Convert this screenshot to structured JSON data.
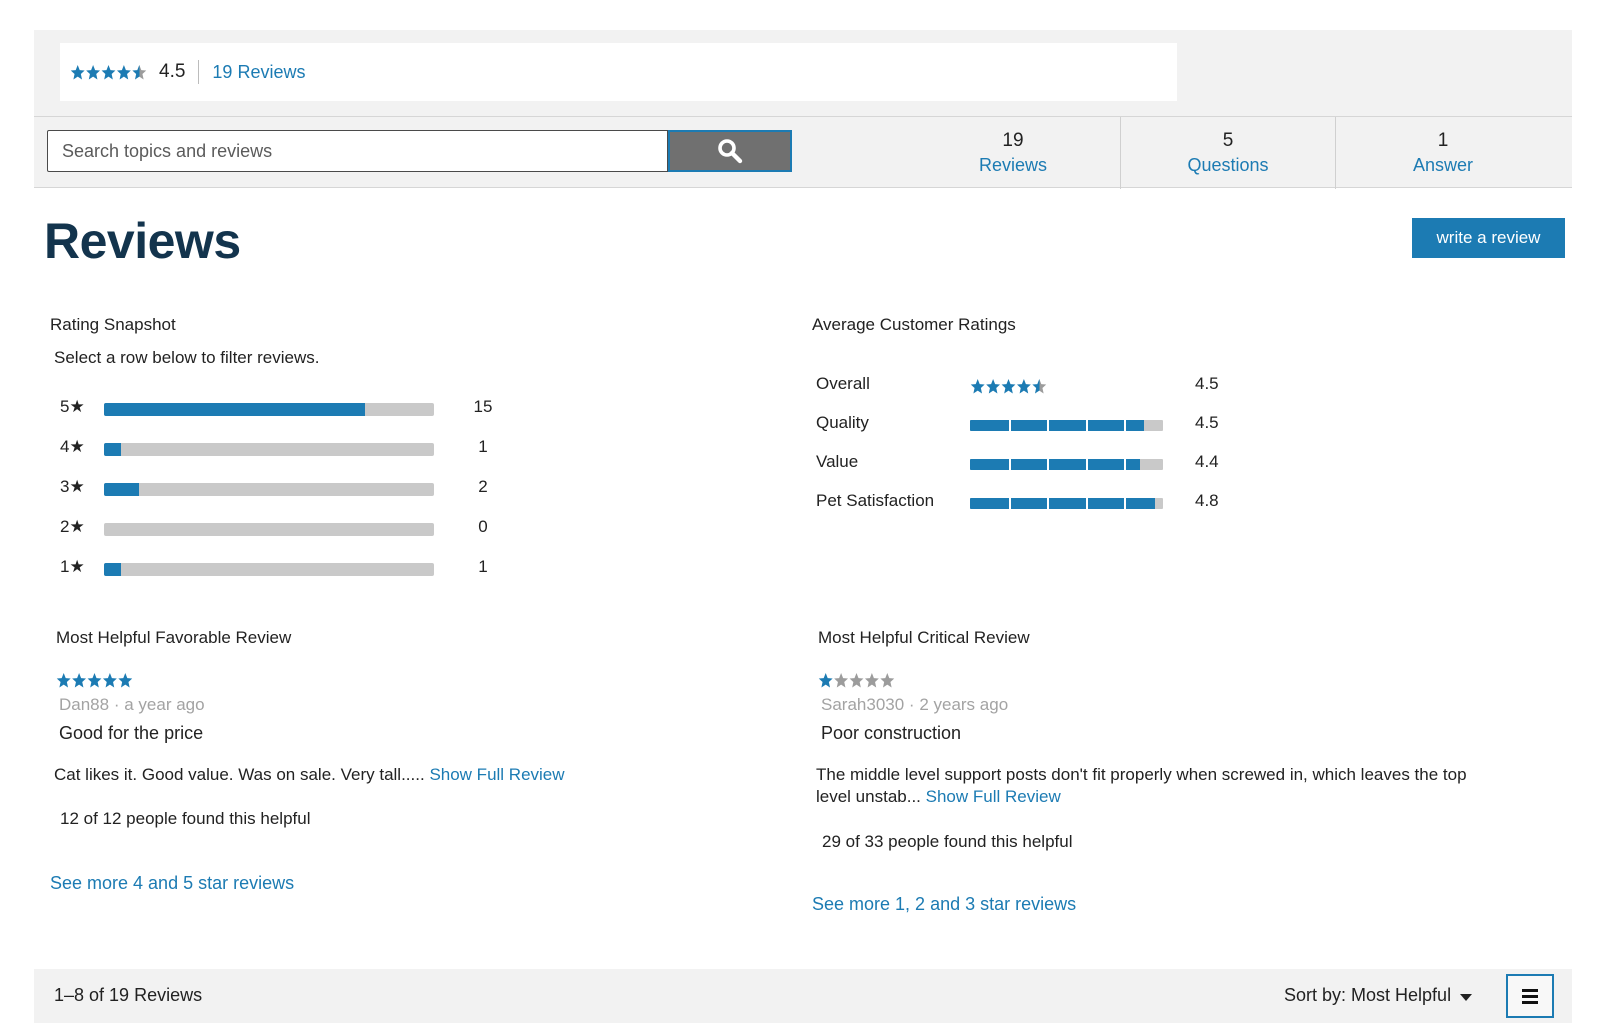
{
  "summary": {
    "rating": 4.5,
    "rating_text": "4.5",
    "reviews_link": "19 Reviews"
  },
  "search": {
    "placeholder": "Search topics and reviews",
    "button_icon": "search-icon"
  },
  "stats": [
    {
      "num": "19",
      "label": "Reviews"
    },
    {
      "num": "5",
      "label": "Questions"
    },
    {
      "num": "1",
      "label": "Answer"
    }
  ],
  "header": {
    "title": "Reviews",
    "write_button": "write a review"
  },
  "snapshot": {
    "title": "Rating Snapshot",
    "subtitle": "Select a row below to filter reviews.",
    "total": 19,
    "rows": [
      {
        "label": "5★",
        "count": "15",
        "value": 15
      },
      {
        "label": "4★",
        "count": "1",
        "value": 1
      },
      {
        "label": "3★",
        "count": "2",
        "value": 2
      },
      {
        "label": "2★",
        "count": "0",
        "value": 0
      },
      {
        "label": "1★",
        "count": "1",
        "value": 1
      }
    ]
  },
  "average": {
    "title": "Average Customer Ratings",
    "rows": [
      {
        "label": "Overall",
        "value": "4.5",
        "rating": 4.5,
        "display": "stars"
      },
      {
        "label": "Quality",
        "value": "4.5",
        "rating": 4.5,
        "display": "bar"
      },
      {
        "label": "Value",
        "value": "4.4",
        "rating": 4.4,
        "display": "bar"
      },
      {
        "label": "Pet Satisfaction",
        "value": "4.8",
        "rating": 4.8,
        "display": "bar"
      }
    ]
  },
  "favorable": {
    "heading": "Most Helpful Favorable Review",
    "rating": 5,
    "author": "Dan88",
    "when": "a year ago",
    "title": "Good for the price",
    "body": "Cat likes it. Good value. Was on sale. Very tall.....",
    "show_full": "Show Full Review",
    "helpful": "12 of 12 people found this helpful",
    "see_more": "See more 4 and 5 star reviews"
  },
  "critical": {
    "heading": "Most Helpful Critical Review",
    "rating": 1,
    "author": "Sarah3030",
    "when": "2 years ago",
    "title": "Poor construction",
    "body": "The middle level support posts don't fit properly when screwed in, which leaves the top level unstab...",
    "show_full": "Show Full Review",
    "helpful": "29 of 33 people found this helpful",
    "see_more": "See more 1, 2 and 3 star reviews"
  },
  "footer": {
    "count": "1–8 of 19 Reviews",
    "sort": "Sort by: Most Helpful",
    "menu_icon": "list-menu-icon"
  },
  "colors": {
    "accent": "#1c7bb3",
    "title": "#13344d",
    "bar_bg": "#c9c9c9",
    "band_bg": "#f2f2f2"
  }
}
